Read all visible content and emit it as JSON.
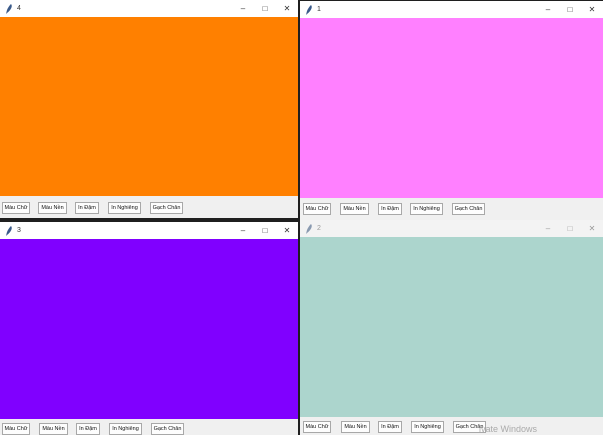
{
  "buttons": {
    "text_color": "Màu Chữ",
    "bg_color": "Màu Nền",
    "bold": "In Đậm",
    "italic": "In Nghiêng",
    "underline": "Gạch Chân"
  },
  "windows": [
    {
      "title": "4",
      "canvas_color": "#ff8000"
    },
    {
      "title": "1",
      "canvas_color": "#ff80ff"
    },
    {
      "title": "3",
      "canvas_color": "#8000ff"
    },
    {
      "title": "2",
      "canvas_color": "#acd5cd"
    }
  ],
  "controls": {
    "minimize": "–",
    "maximize": "□",
    "close": "✕"
  },
  "watermark": "ivate Windows"
}
